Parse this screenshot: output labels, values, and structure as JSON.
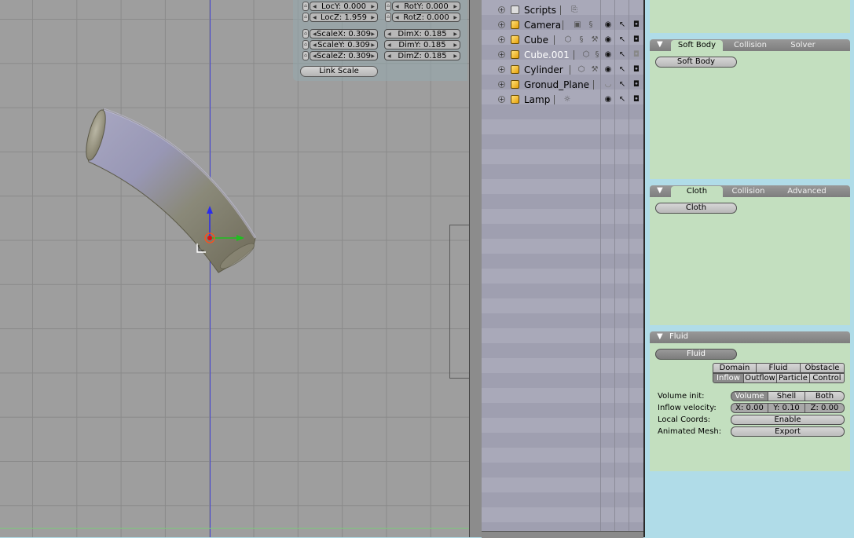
{
  "transform": {
    "locy": "LocY: 0.000",
    "locz": "LocZ: 1.959",
    "roty": "RotY: 0.000",
    "rotz": "RotZ: 0.000",
    "scalex": "ScaleX: 0.309",
    "scaley": "ScaleY: 0.309",
    "scalez": "ScaleZ: 0.309",
    "dimx": "DimX: 0.185",
    "dimy": "DimY: 0.185",
    "dimz": "DimZ: 0.185",
    "link_scale": "Link Scale"
  },
  "outliner": {
    "items": [
      {
        "label": "Scripts",
        "icon": "script-icon"
      },
      {
        "label": "Camera",
        "icon": "camera-object-icon"
      },
      {
        "label": "Cube",
        "icon": "mesh-object-icon"
      },
      {
        "label": "Cube.001",
        "icon": "mesh-object-icon",
        "selected": true
      },
      {
        "label": "Cylinder",
        "icon": "mesh-object-icon"
      },
      {
        "label": "Gronud_Plane",
        "icon": "mesh-object-icon"
      },
      {
        "label": "Lamp",
        "icon": "lamp-object-icon"
      }
    ]
  },
  "softbody_panel": {
    "tabs": [
      "Soft Body",
      "Collision",
      "Solver"
    ],
    "toggle": "Soft Body"
  },
  "cloth_panel": {
    "tabs": [
      "Cloth",
      "Collision",
      "Advanced"
    ],
    "toggle": "Cloth"
  },
  "fluid_panel": {
    "title": "Fluid",
    "toggle": "Fluid",
    "type_row1": [
      "Domain",
      "Fluid",
      "Obstacle"
    ],
    "type_row2": [
      "Inflow",
      "Outflow",
      "Particle",
      "Control"
    ],
    "volume_init_label": "Volume init:",
    "volume_init_options": [
      "Volume",
      "Shell",
      "Both"
    ],
    "inflow_velocity_label": "Inflow velocity:",
    "inflow_x": "X: 0.00",
    "inflow_y": "Y: 0.10",
    "inflow_z": "Z: 0.00",
    "local_coords_label": "Local Coords:",
    "local_coords_button": "Enable",
    "animated_mesh_label": "Animated Mesh:",
    "animated_mesh_button": "Export"
  },
  "colors": {
    "viewport_bg": "#9e9e9e",
    "panel_bg": "#c3dfbf",
    "buttons_bg": "#b0dce8",
    "selected_text": "#ffffff"
  }
}
